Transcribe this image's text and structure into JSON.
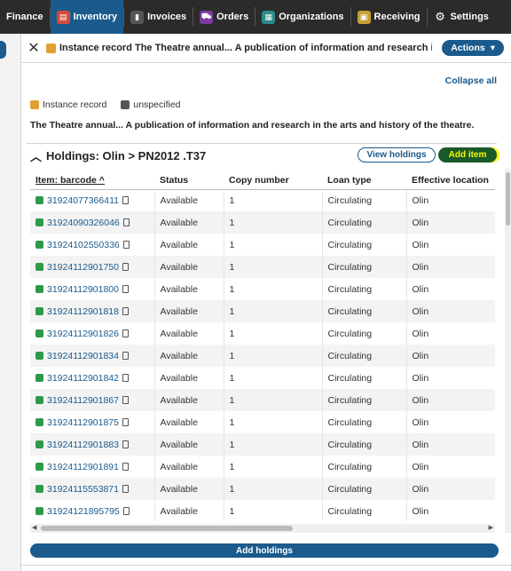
{
  "nav": {
    "items": [
      {
        "label": "Finance",
        "active": false
      },
      {
        "label": "Inventory",
        "active": true
      },
      {
        "label": "Invoices",
        "active": false
      },
      {
        "label": "Orders",
        "active": false
      },
      {
        "label": "Organizations",
        "active": false
      },
      {
        "label": "Receiving",
        "active": false
      },
      {
        "label": "Settings",
        "active": false
      }
    ]
  },
  "record": {
    "title": "Instance record The Theatre annual... A publication of information and research in the a...",
    "actions_label": "Actions",
    "collapse_all": "Collapse all",
    "type_label": "Instance record",
    "status_label": "unspecified",
    "long_title": "The Theatre annual... A publication of information and research in the arts and history of the theatre."
  },
  "holdings": {
    "heading": "Holdings: Olin > PN2012 .T37",
    "view_label": "View holdings",
    "add_item_label": "Add item",
    "columns": [
      "Item: barcode",
      "Status",
      "Copy number",
      "Loan type",
      "Effective location"
    ],
    "rows": [
      [
        "31924077366411",
        "Available",
        "1",
        "Circulating",
        "Olin"
      ],
      [
        "31924090326046",
        "Available",
        "1",
        "Circulating",
        "Olin"
      ],
      [
        "31924102550336",
        "Available",
        "1",
        "Circulating",
        "Olin"
      ],
      [
        "31924112901750",
        "Available",
        "1",
        "Circulating",
        "Olin"
      ],
      [
        "31924112901800",
        "Available",
        "1",
        "Circulating",
        "Olin"
      ],
      [
        "31924112901818",
        "Available",
        "1",
        "Circulating",
        "Olin"
      ],
      [
        "31924112901826",
        "Available",
        "1",
        "Circulating",
        "Olin"
      ],
      [
        "31924112901834",
        "Available",
        "1",
        "Circulating",
        "Olin"
      ],
      [
        "31924112901842",
        "Available",
        "1",
        "Circulating",
        "Olin"
      ],
      [
        "31924112901867",
        "Available",
        "1",
        "Circulating",
        "Olin"
      ],
      [
        "31924112901875",
        "Available",
        "1",
        "Circulating",
        "Olin"
      ],
      [
        "31924112901883",
        "Available",
        "1",
        "Circulating",
        "Olin"
      ],
      [
        "31924112901891",
        "Available",
        "1",
        "Circulating",
        "Olin"
      ],
      [
        "31924115553871",
        "Available",
        "1",
        "Circulating",
        "Olin"
      ],
      [
        "31924121895795",
        "Available",
        "1",
        "Circulating",
        "Olin"
      ]
    ],
    "add_holdings_label": "Add holdings"
  }
}
